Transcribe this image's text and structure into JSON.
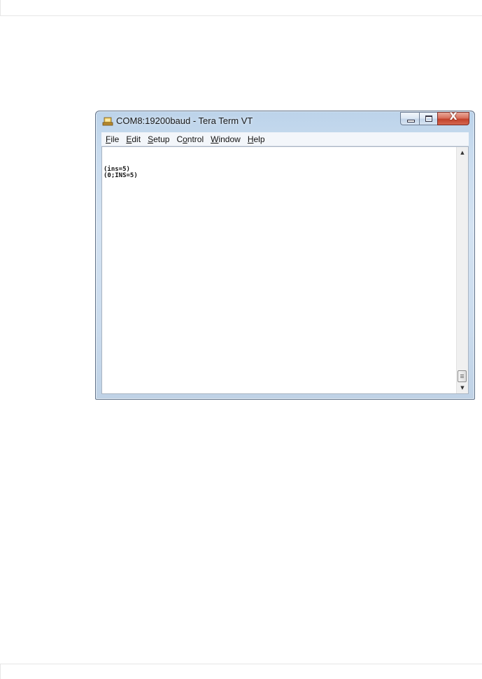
{
  "window": {
    "title": "COM8:19200baud - Tera Term VT",
    "icon": "tera-term-app-icon"
  },
  "caption_buttons": {
    "minimize_icon": "minimize-icon",
    "maximize_icon": "maximize-icon",
    "close_icon": "close-icon",
    "close_glyph": "X"
  },
  "menu": {
    "items": [
      {
        "pre": "",
        "key": "F",
        "post": "ile"
      },
      {
        "pre": "",
        "key": "E",
        "post": "dit"
      },
      {
        "pre": "",
        "key": "S",
        "post": "etup"
      },
      {
        "pre": "C",
        "key": "o",
        "post": "ntrol"
      },
      {
        "pre": "",
        "key": "W",
        "post": "indow"
      },
      {
        "pre": "",
        "key": "H",
        "post": "elp"
      }
    ]
  },
  "terminal": {
    "lines": [
      "(ins=5)",
      "(0;INS=5)"
    ]
  },
  "scrollbar": {
    "up_arrow": "▲",
    "down_arrow": "▼"
  },
  "colors": {
    "close_button": "#c2422b",
    "title_bar": "#c9dcef",
    "terminal_background": "#ffffff"
  }
}
